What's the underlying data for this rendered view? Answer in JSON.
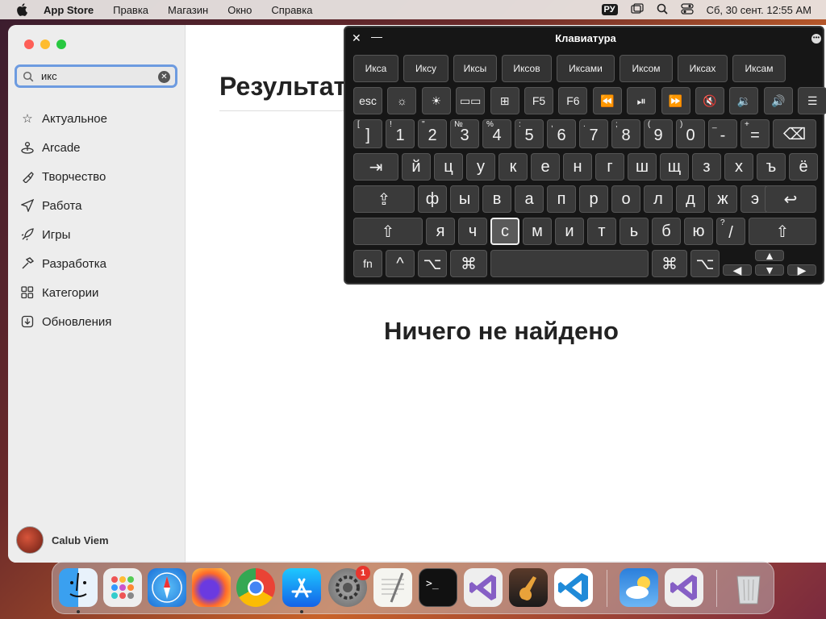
{
  "menubar": {
    "app_name": "App Store",
    "items": [
      "Правка",
      "Магазин",
      "Окно",
      "Справка"
    ],
    "lang": "РУ",
    "datetime": "Сб, 30 сент.  12:55 AM"
  },
  "sidebar": {
    "search_value": "икс",
    "items": [
      {
        "label": "Актуальное",
        "icon": "star-icon"
      },
      {
        "label": "Arcade",
        "icon": "joystick-icon"
      },
      {
        "label": "Творчество",
        "icon": "brush-icon"
      },
      {
        "label": "Работа",
        "icon": "paper-plane-icon"
      },
      {
        "label": "Игры",
        "icon": "rocket-icon"
      },
      {
        "label": "Разработка",
        "icon": "hammer-icon"
      },
      {
        "label": "Категории",
        "icon": "grid-icon"
      },
      {
        "label": "Обновления",
        "icon": "download-icon"
      }
    ],
    "user_name": "Calub Viem"
  },
  "main": {
    "results_title": "Результат",
    "empty_message": "Ничего не найдено"
  },
  "keyboard": {
    "title": "Клавиатура",
    "suggestions": [
      "Икса",
      "Иксу",
      "Иксы",
      "Иксов",
      "Иксами",
      "Иксом",
      "Иксах",
      "Иксам"
    ],
    "fn_row": [
      "esc",
      "☼",
      "☀",
      "▭▭",
      "⊞",
      "F5",
      "F6",
      "⏪",
      "⏯",
      "⏩",
      "🔇",
      "🔉",
      "🔊",
      "☰"
    ],
    "num_row": [
      {
        "top": "[",
        "main": "]"
      },
      {
        "top": "!",
        "main": "1"
      },
      {
        "top": "\"",
        "main": "2"
      },
      {
        "top": "№",
        "main": "3"
      },
      {
        "top": "%",
        "main": "4"
      },
      {
        "top": ":",
        "main": "5"
      },
      {
        "top": ",",
        "main": "6"
      },
      {
        "top": ".",
        "main": "7"
      },
      {
        "top": ";",
        "main": "8"
      },
      {
        "top": "(",
        "main": "9"
      },
      {
        "top": ")",
        "main": "0"
      },
      {
        "top": "_",
        "main": "-"
      },
      {
        "top": "+",
        "main": "="
      }
    ],
    "row1": [
      "й",
      "ц",
      "у",
      "к",
      "е",
      "н",
      "г",
      "ш",
      "щ",
      "з",
      "х",
      "ъ",
      "ё"
    ],
    "row2": [
      "ф",
      "ы",
      "в",
      "а",
      "п",
      "р",
      "о",
      "л",
      "д",
      "ж",
      "э"
    ],
    "row3": [
      "я",
      "ч",
      "с",
      "м",
      "и",
      "т",
      "ь",
      "б",
      "ю"
    ],
    "row3_slash": {
      "top": "?",
      "main": "/"
    },
    "selected_key": "с",
    "bottom": {
      "fn": "fn",
      "ctrl": "^",
      "opt": "⌥",
      "cmd": "⌘",
      "cmd_r": "⌘",
      "opt_r": "⌥"
    },
    "special": {
      "tab": "⇥",
      "caps": "⇪",
      "shift": "⇧",
      "return": "↩",
      "delete": "⌫"
    },
    "arrows": {
      "up": "▲",
      "down": "▼",
      "left": "◀",
      "right": "▶"
    }
  },
  "dock": {
    "badge": "1",
    "apps": [
      "finder-icon",
      "launchpad-icon",
      "safari-icon",
      "firefox-icon",
      "chrome-icon",
      "app-store-icon",
      "system-settings-icon",
      "textedit-icon",
      "terminal-icon",
      "visual-studio-icon",
      "garageband-icon",
      "vscode-icon",
      "weather-icon",
      "visual-studio-2-icon",
      "trash-icon"
    ]
  },
  "colors": {
    "accent": "#6d9be0",
    "close": "#fe5f57",
    "minimize": "#febc2e",
    "zoom": "#28c840"
  }
}
